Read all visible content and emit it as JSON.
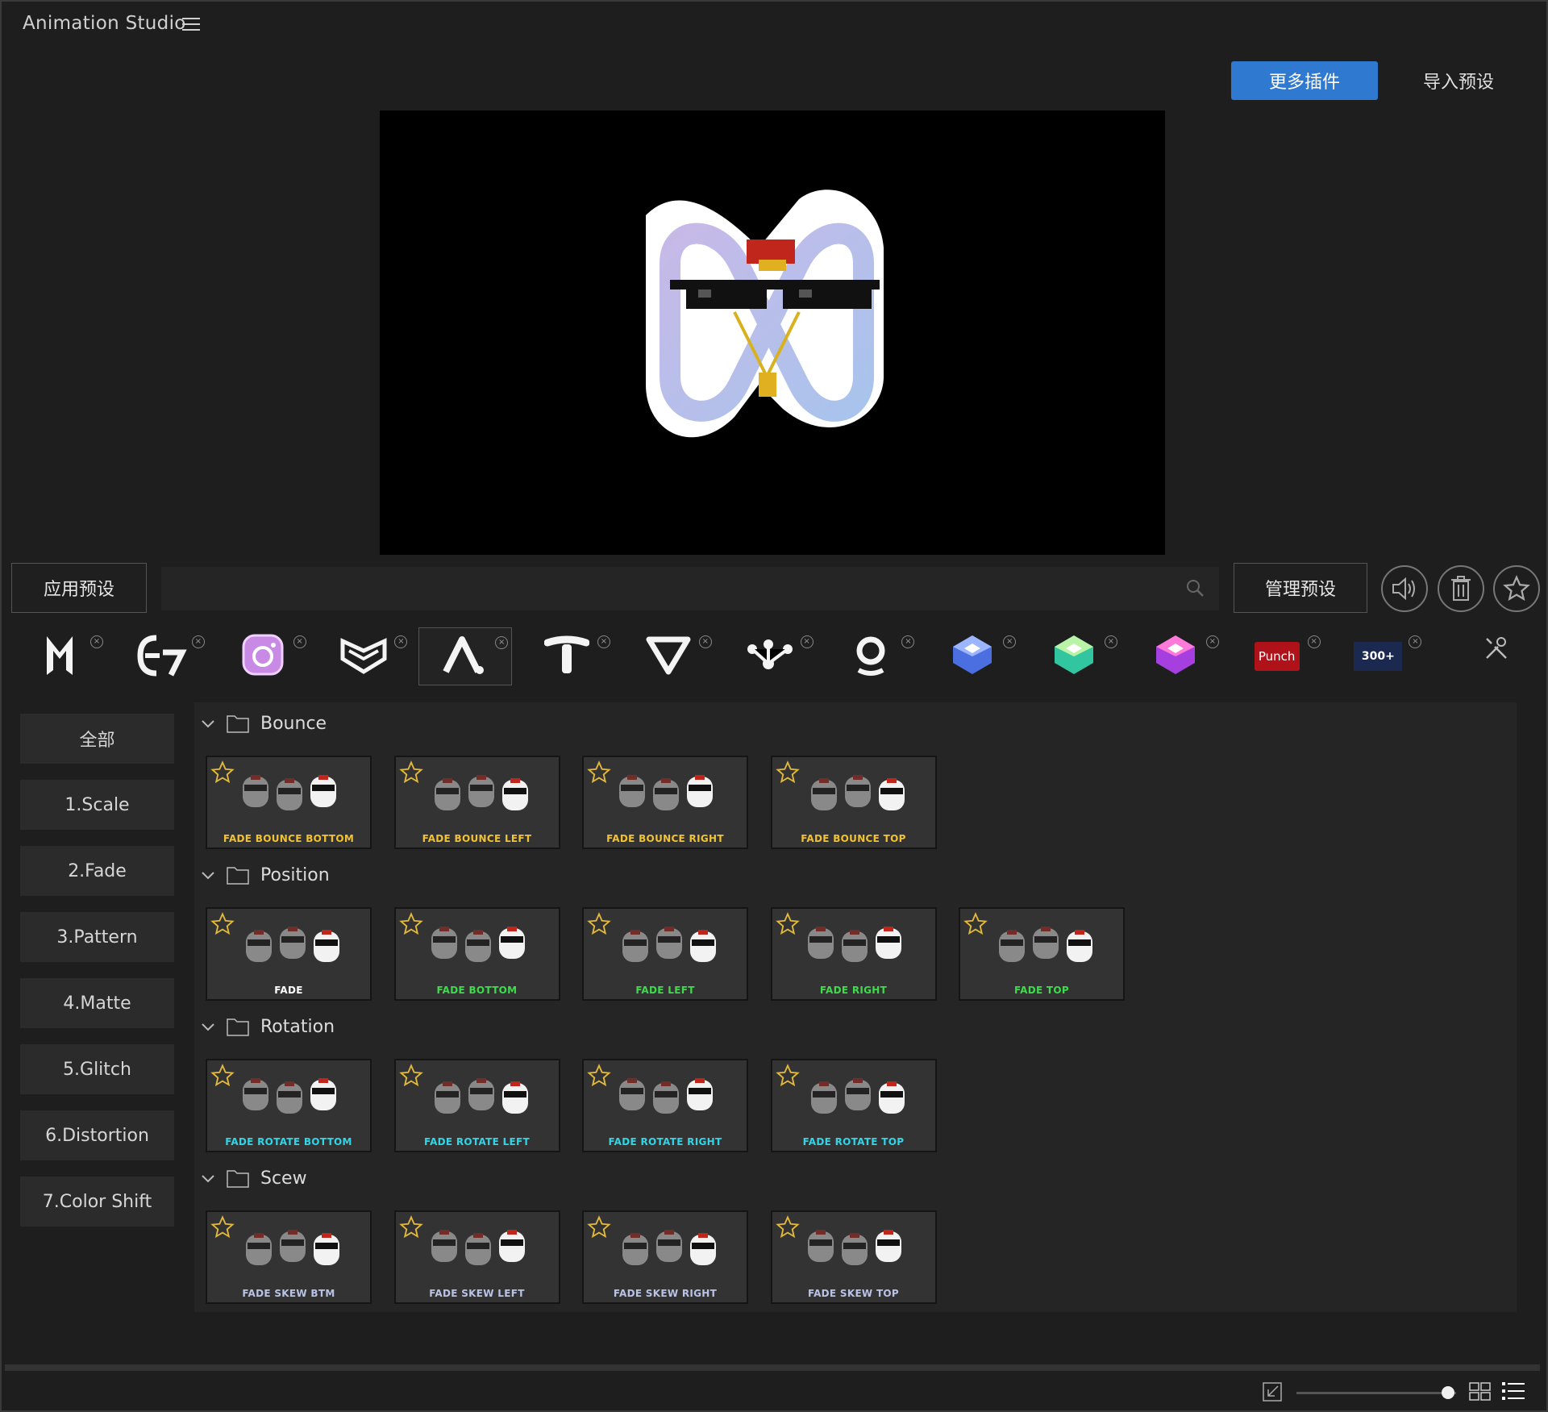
{
  "app": {
    "title": "Animation Studio"
  },
  "header": {
    "more_plugins": "更多插件",
    "import_preset": "导入预设"
  },
  "toolbar": {
    "apply_preset": "应用预设",
    "search_placeholder": "",
    "manage_presets": "管理预设"
  },
  "plugins": [
    {
      "icon": "m-logo-icon",
      "active": false
    },
    {
      "icon": "e7-logo-icon",
      "active": false
    },
    {
      "icon": "camera-logo-icon",
      "active": false
    },
    {
      "icon": "shield-logo-icon",
      "active": false
    },
    {
      "icon": "a-logo-icon",
      "active": true
    },
    {
      "icon": "t-logo-icon",
      "active": false
    },
    {
      "icon": "v-logo-icon",
      "active": false
    },
    {
      "icon": "nodes-logo-icon",
      "active": false
    },
    {
      "icon": "ring-logo-icon",
      "active": false
    },
    {
      "icon": "blue-cube-icon",
      "active": false
    },
    {
      "icon": "green-cube-icon",
      "active": false
    },
    {
      "icon": "purple-cube-icon",
      "active": false
    },
    {
      "icon": "punch-logo-icon",
      "active": false,
      "text": "Punch"
    },
    {
      "icon": "300-transitions-icon",
      "active": false,
      "text": "300+"
    }
  ],
  "categories": [
    "全部",
    "1.Scale",
    "2.Fade",
    "3.Pattern",
    "4.Matte",
    "5.Glitch",
    "6.Distortion",
    "7.Color Shift"
  ],
  "groups": [
    {
      "name": "Bounce",
      "items": [
        {
          "label": "FADE BOUNCE BOTTOM",
          "color": "#f2c230"
        },
        {
          "label": "FADE BOUNCE LEFT",
          "color": "#f2c230"
        },
        {
          "label": "FADE BOUNCE RIGHT",
          "color": "#f2c230"
        },
        {
          "label": "FADE BOUNCE TOP",
          "color": "#f2c230"
        }
      ]
    },
    {
      "name": "Position",
      "items": [
        {
          "label": "FADE",
          "color": "#ffffff"
        },
        {
          "label": "FADE BOTTOM",
          "color": "#3ddc4a"
        },
        {
          "label": "FADE LEFT",
          "color": "#3ddc4a"
        },
        {
          "label": "FADE RIGHT",
          "color": "#3ddc4a"
        },
        {
          "label": "FADE TOP",
          "color": "#3ddc4a"
        }
      ]
    },
    {
      "name": "Rotation",
      "items": [
        {
          "label": "FADE ROTATE BOTTOM",
          "color": "#2fd6e8"
        },
        {
          "label": "FADE ROTATE LEFT",
          "color": "#2fd6e8"
        },
        {
          "label": "FADE ROTATE RIGHT",
          "color": "#2fd6e8"
        },
        {
          "label": "FADE ROTATE TOP",
          "color": "#2fd6e8"
        }
      ]
    },
    {
      "name": "Scew",
      "items": [
        {
          "label": "FADE SKEW BTM",
          "color": "#b9c3e6"
        },
        {
          "label": "FADE SKEW LEFT",
          "color": "#b9c3e6"
        },
        {
          "label": "FADE SKEW RIGHT",
          "color": "#b9c3e6"
        },
        {
          "label": "FADE SKEW TOP",
          "color": "#b9c3e6"
        }
      ]
    }
  ],
  "icons": {
    "volume": "volume-icon",
    "trash": "trash-icon",
    "favorite": "star-icon",
    "tools": "tools-icon",
    "shrink": "shrink-icon",
    "grid": "grid-view-icon",
    "list": "list-view-icon"
  },
  "zoom_slider_level": 0.95,
  "colors": {
    "accent": "#2f7ad0",
    "background": "#1e1e1e",
    "panel": "#252525"
  }
}
